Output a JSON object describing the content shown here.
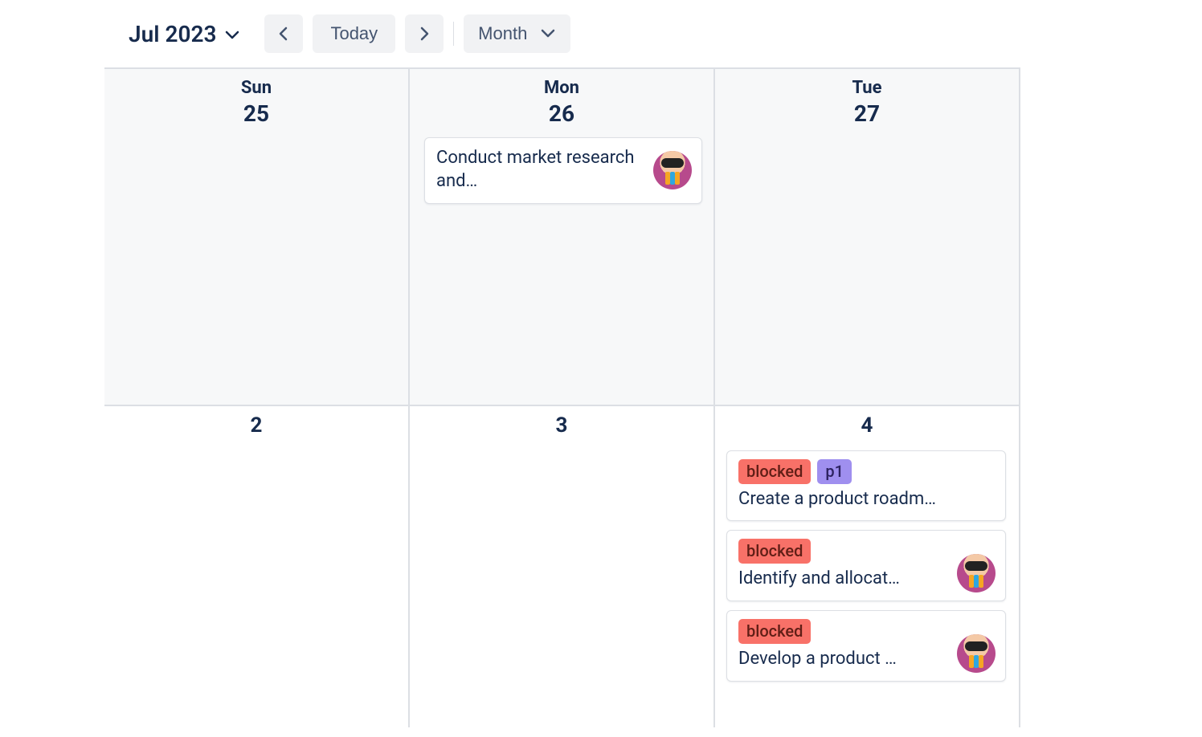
{
  "toolbar": {
    "month_label": "Jul 2023",
    "today_label": "Today",
    "view_label": "Month"
  },
  "week1": {
    "sun": {
      "dow": "Sun",
      "num": "25"
    },
    "mon": {
      "dow": "Mon",
      "num": "26"
    },
    "tue": {
      "dow": "Tue",
      "num": "27"
    }
  },
  "week2": {
    "sun": {
      "num": "2"
    },
    "mon": {
      "num": "3"
    },
    "tue": {
      "num": "4"
    }
  },
  "labels": {
    "blocked": "blocked",
    "p1": "p1"
  },
  "cards": {
    "mon26_market": "Conduct market research and…",
    "tue4_roadmap": "Create a product roadm…",
    "tue4_allocate": "Identify and allocat…",
    "tue4_develop": "Develop a product …"
  }
}
